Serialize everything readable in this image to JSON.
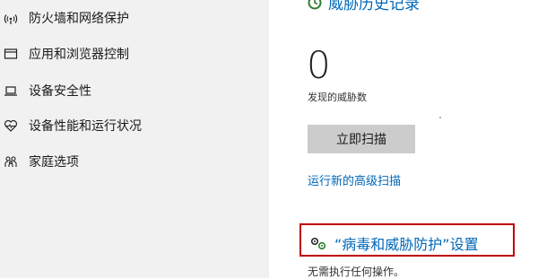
{
  "sidebar": {
    "items": [
      {
        "label": "防火墙和网络保护",
        "icon": "wifi-icon"
      },
      {
        "label": "应用和浏览器控制",
        "icon": "browser-window-icon"
      },
      {
        "label": "设备安全性",
        "icon": "laptop-icon"
      },
      {
        "label": "设备性能和运行状况",
        "icon": "heart-icon"
      },
      {
        "label": "家庭选项",
        "icon": "family-icon"
      }
    ]
  },
  "main": {
    "history_link": "威胁历史记录",
    "threat_count": "0",
    "threat_count_label": "发现的威胁数",
    "scan_button": "立即扫描",
    "advanced_scan_link": "运行新的高级扫描",
    "settings_link": "“病毒和威胁防护”设置",
    "settings_status": "无需执行任何操作。"
  },
  "colors": {
    "sidebar_bg": "#f1f1f1",
    "link": "#0067b8",
    "button_bg": "#cccccc",
    "highlight_border": "#c00000",
    "settings_icon_green": "#2e7d32"
  }
}
